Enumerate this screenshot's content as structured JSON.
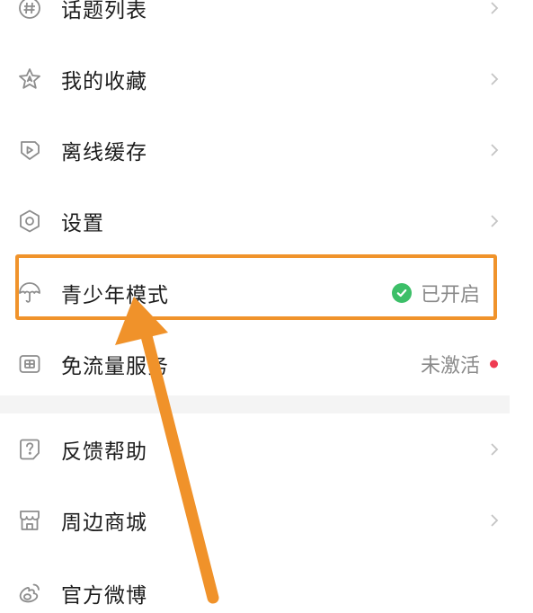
{
  "menu": {
    "topic_list": {
      "label": "话题列表",
      "icon": "hashtag-icon"
    },
    "favorites": {
      "label": "我的收藏",
      "icon": "star-icon"
    },
    "offline_cache": {
      "label": "离线缓存",
      "icon": "download-icon"
    },
    "settings": {
      "label": "设置",
      "icon": "gear-icon"
    },
    "teen_mode": {
      "label": "青少年模式",
      "icon": "umbrella-icon",
      "status": "已开启",
      "status_icon": "check-circle-icon"
    },
    "data_free": {
      "label": "免流量服务",
      "icon": "sim-card-icon",
      "status": "未激活",
      "status_icon": "red-dot"
    },
    "feedback": {
      "label": "反馈帮助",
      "icon": "help-icon"
    },
    "shop": {
      "label": "周边商城",
      "icon": "shop-icon"
    },
    "weibo": {
      "label": "官方微博",
      "icon": "weibo-icon"
    }
  },
  "colors": {
    "highlight": "#f0932b",
    "arrow": "#f0922a",
    "check": "#3cbf68",
    "dot": "#ef3b52",
    "label": "#1c1c1c",
    "status": "#8a8a8a",
    "icon": "#8d8d8d"
  }
}
